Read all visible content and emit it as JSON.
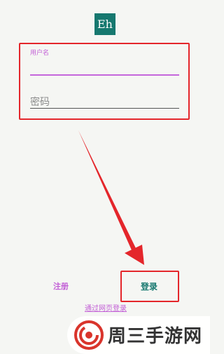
{
  "app": {
    "logo_text": "Eh",
    "accent_color": "#16786f",
    "secondary_color": "#c25fd6",
    "highlight_color": "#e4262b"
  },
  "form": {
    "username_label": "用户名",
    "username_value": "",
    "password_placeholder": "密码"
  },
  "actions": {
    "register_label": "注册",
    "login_label": "登录",
    "web_login_label": "通过网页登录"
  },
  "watermark": {
    "text": "周三手游网",
    "icon": "spiral-logo-icon"
  }
}
